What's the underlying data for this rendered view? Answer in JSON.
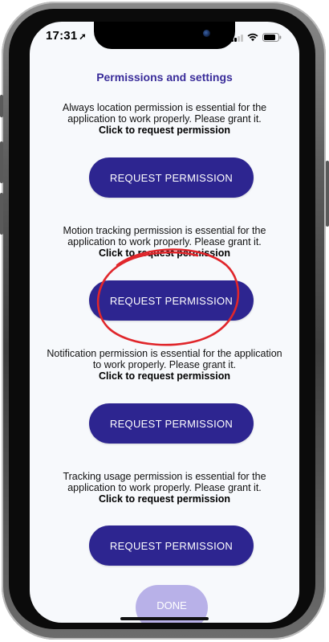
{
  "status_bar": {
    "time": "17:31",
    "location_icon": "location-arrow-icon",
    "signal_icon": "cellular-signal-icon",
    "wifi_icon": "wifi-icon",
    "battery_icon": "battery-icon"
  },
  "page": {
    "title": "Permissions and settings"
  },
  "permissions": [
    {
      "description": "Always location permission is essential for the application to work properly. Please grant it.",
      "note": "Click to request permission",
      "button_label": "REQUEST PERMISSION"
    },
    {
      "description": "Motion tracking permission is essential for the application to work properly. Please grant it.",
      "note": "Click to request permission",
      "button_label": "REQUEST PERMISSION"
    },
    {
      "description": "Notification permission is essential for the application to work properly. Please grant it.",
      "note": "Click to request permission",
      "button_label": "REQUEST PERMISSION"
    },
    {
      "description": "Tracking usage permission is essential for the application to work properly. Please grant it.",
      "note": "Click to request permission",
      "button_label": "REQUEST PERMISSION"
    }
  ],
  "done": {
    "label": "DONE",
    "state": "disabled"
  },
  "colors": {
    "accent": "#2d2590",
    "title": "#3a2d9a",
    "done_disabled": "#b8b1e8",
    "annotation": "#e0262b"
  },
  "annotation": {
    "shape": "hand-drawn red circle",
    "target": "second request permission button"
  }
}
